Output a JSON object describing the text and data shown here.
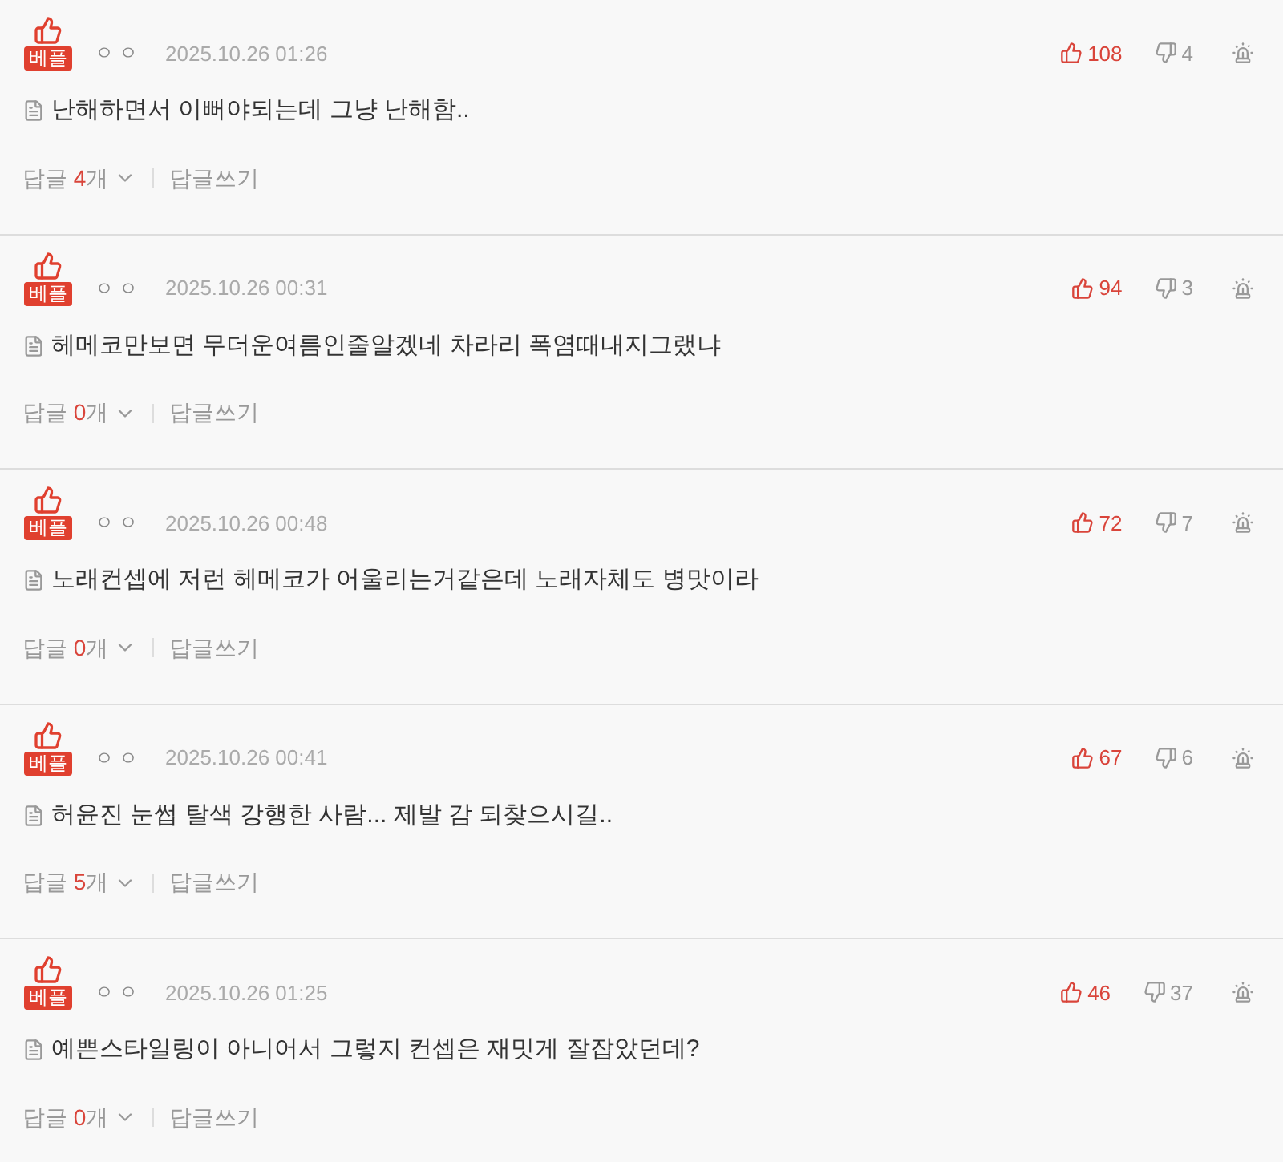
{
  "comments": [
    {
      "badge": "베플",
      "author": "ㅇㅇ",
      "date": "2025.10.26 01:26",
      "likes": "108",
      "dislikes": "4",
      "text": "난해하면서 이뻐야되는데 그냥 난해함..",
      "reply_label": "답글",
      "reply_count": "4",
      "reply_unit": "개",
      "write_reply": "답글쓰기"
    },
    {
      "badge": "베플",
      "author": "ㅇㅇ",
      "date": "2025.10.26 00:31",
      "likes": "94",
      "dislikes": "3",
      "text": "헤메코만보면 무더운여름인줄알겠네 차라리 폭염때내지그랬냐",
      "reply_label": "답글",
      "reply_count": "0",
      "reply_unit": "개",
      "write_reply": "답글쓰기"
    },
    {
      "badge": "베플",
      "author": "ㅇㅇ",
      "date": "2025.10.26 00:48",
      "likes": "72",
      "dislikes": "7",
      "text": "노래컨셉에 저런 헤메코가 어울리는거같은데 노래자체도 병맛이라",
      "reply_label": "답글",
      "reply_count": "0",
      "reply_unit": "개",
      "write_reply": "답글쓰기"
    },
    {
      "badge": "베플",
      "author": "ㅇㅇ",
      "date": "2025.10.26 00:41",
      "likes": "67",
      "dislikes": "6",
      "text": "허윤진 눈썹 탈색 강행한 사람... 제발 감 되찾으시길..",
      "reply_label": "답글",
      "reply_count": "5",
      "reply_unit": "개",
      "write_reply": "답글쓰기"
    },
    {
      "badge": "베플",
      "author": "ㅇㅇ",
      "date": "2025.10.26 01:25",
      "likes": "46",
      "dislikes": "37",
      "text": "예쁜스타일링이 아니어서 그렇지 컨셉은 재밋게 잘잡았던데?",
      "reply_label": "답글",
      "reply_count": "0",
      "reply_unit": "개",
      "write_reply": "답글쓰기"
    }
  ]
}
